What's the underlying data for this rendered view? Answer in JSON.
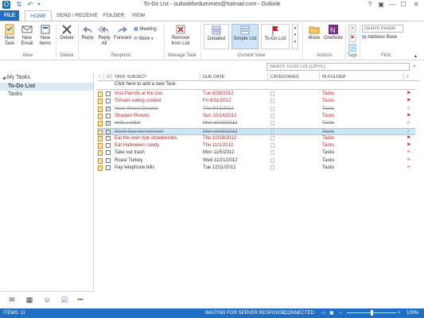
{
  "window": {
    "title": "To-Do List - outlookfordummies@hotmail.com - Outlook",
    "controls": {
      "help": "?",
      "ribbon_options": "▣",
      "minimize": "—",
      "maximize": "☐",
      "close": "✕"
    }
  },
  "tabs": [
    "FILE",
    "HOME",
    "SEND / RECEIVE",
    "FOLDER",
    "VIEW"
  ],
  "ribbon": {
    "groups": {
      "new": "New",
      "delete": "Delete",
      "respond": "Respond",
      "manage_task": "Manage Task",
      "current_view": "Current View",
      "actions": "Actions",
      "tags": "Tags",
      "find": "Find"
    },
    "buttons": {
      "new_task": "New\nTask",
      "new_email": "New\nEmail",
      "new_items": "New\nItems",
      "delete": "Delete",
      "reply": "Reply",
      "reply_all": "Reply\nAll",
      "forward": "Forward",
      "meeting": "Meeting",
      "more": "More",
      "remove_from_list": "Remove\nfrom List",
      "detailed": "Detailed",
      "simple_list": "Simple List",
      "to_do_list": "To-Do List",
      "move": "Move",
      "onenote": "OneNote",
      "search_people_placeholder": "Search People",
      "address_book": "Address Book"
    }
  },
  "search": {
    "placeholder": "Search To-Do List (Ctrl+E)"
  },
  "nav": {
    "header": "My Tasks",
    "items": [
      "To-Do List",
      "Tasks"
    ]
  },
  "grid": {
    "columns": {
      "subject": "TASK SUBJECT",
      "due": "DUE DATE",
      "categories": "CATEGORIES",
      "folder": "IN FOLDER"
    },
    "new_task_prompt": "Click here to add a new Task",
    "rows": [
      {
        "subject": "Visit Parrots at the zoo",
        "due": "Tue 8/28/2012",
        "folder": "Tasks",
        "state": "overdue",
        "complete": false
      },
      {
        "subject": "Tomato eating contest",
        "due": "Fri 8/31/2012",
        "folder": "Tasks",
        "state": "overdue",
        "complete": false
      },
      {
        "subject": "Have Sweet Dreams",
        "due": "Thu 9/13/2012",
        "folder": "Tasks",
        "state": "done",
        "complete": true
      },
      {
        "subject": "Sharpen Pencils",
        "due": "Sun 10/14/2012",
        "folder": "Tasks",
        "state": "overdue",
        "complete": false
      },
      {
        "subject": "write a letter",
        "due": "Mon 10/15/2012",
        "folder": "Tasks",
        "state": "done",
        "complete": true
      },
      {
        "subject": "Wash face but not ears",
        "due": "Mon 10/15/2012",
        "folder": "Tasks",
        "state": "done",
        "complete": true
      },
      {
        "subject": "Eat the over ripe strawberries",
        "due": "Thu 10/18/2012",
        "folder": "Tasks",
        "state": "overdue",
        "complete": false
      },
      {
        "subject": "Eat Halloween candy",
        "due": "Thu 11/1/2012",
        "folder": "Tasks",
        "state": "overdue",
        "complete": false
      },
      {
        "subject": "Take out trash",
        "due": "Mon 11/5/2012",
        "folder": "Tasks",
        "state": "normal",
        "complete": false
      },
      {
        "subject": "Roast Turkey",
        "due": "Wed 11/21/2012",
        "folder": "Tasks",
        "state": "normal",
        "complete": false
      },
      {
        "subject": "Pay telephone bills",
        "due": "Tue 12/11/2012",
        "folder": "Tasks",
        "state": "normal",
        "complete": false
      }
    ]
  },
  "bottom_nav": {
    "more": "•••"
  },
  "status": {
    "items": "ITEMS: 11",
    "waiting": "WAITING FOR SERVER RESPONSE...",
    "connected": "CONNECTED",
    "zoom": "100%"
  },
  "colors": {
    "accent": "#1f6fc5",
    "overdue": "#c0262a",
    "selected_row": "#cde6f7"
  }
}
